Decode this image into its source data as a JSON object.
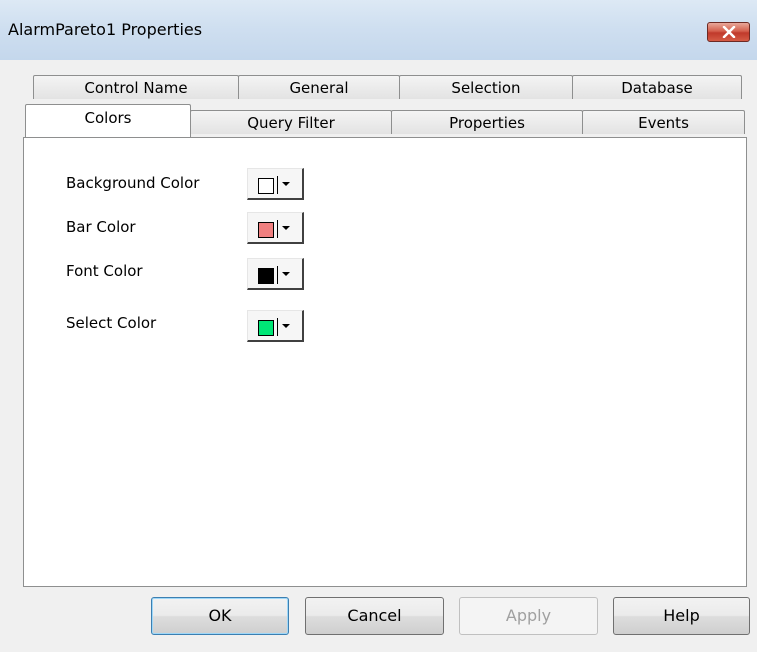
{
  "window": {
    "title": "AlarmPareto1 Properties"
  },
  "tabs": {
    "back_row": [
      {
        "label": "Control Name"
      },
      {
        "label": "General"
      },
      {
        "label": "Selection"
      },
      {
        "label": "Database"
      }
    ],
    "front_row": [
      {
        "label": "Colors",
        "active": true
      },
      {
        "label": "Query Filter"
      },
      {
        "label": "Properties"
      },
      {
        "label": "Events"
      }
    ]
  },
  "colors_panel": {
    "rows": [
      {
        "label": "Background Color",
        "color": "#ffffff"
      },
      {
        "label": "Bar Color",
        "color": "#f08080"
      },
      {
        "label": "Font Color",
        "color": "#000000"
      },
      {
        "label": "Select Color",
        "color": "#00e676"
      }
    ]
  },
  "buttons": {
    "ok": "OK",
    "cancel": "Cancel",
    "apply": "Apply",
    "help": "Help"
  }
}
